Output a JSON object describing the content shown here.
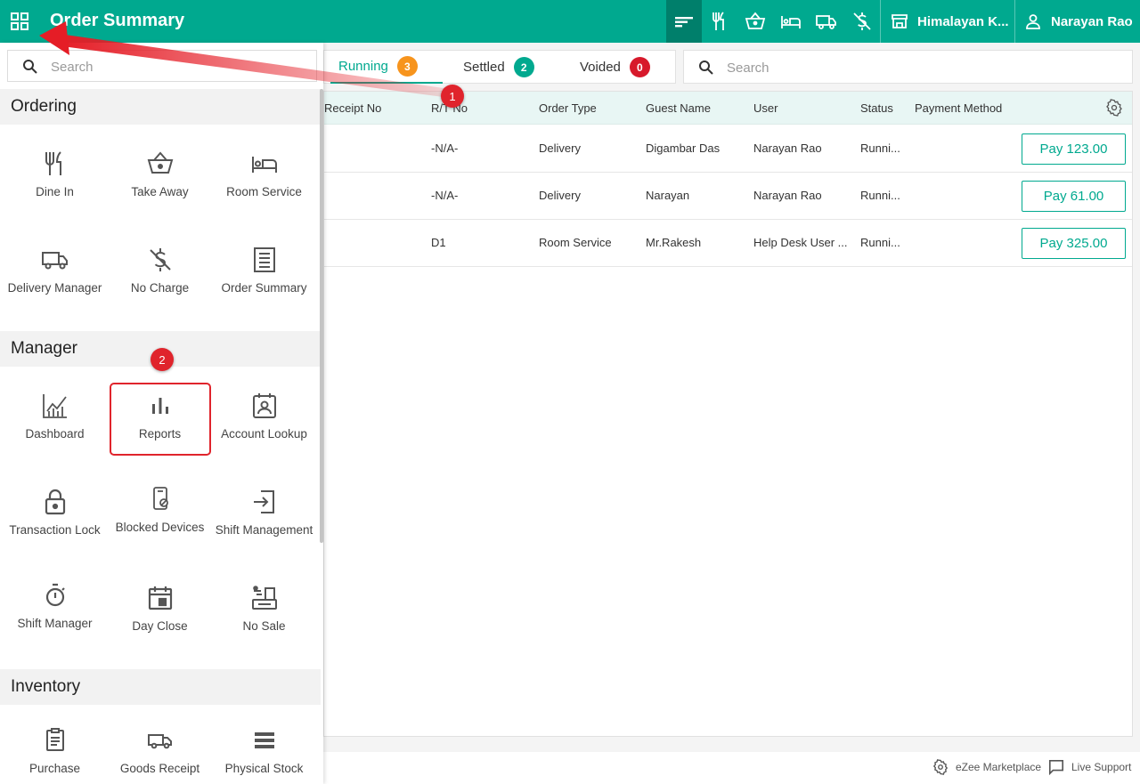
{
  "topbar": {
    "title": "Order Summary",
    "outlet": "Himalayan K...",
    "user": "Narayan Rao",
    "icons": [
      "order-summary-icon",
      "dine-in-icon",
      "take-away-icon",
      "room-service-icon",
      "delivery-icon",
      "no-charge-icon"
    ]
  },
  "sidebar": {
    "search_placeholder": "Search",
    "sections": {
      "ordering": {
        "title": "Ordering",
        "items": [
          {
            "label": "Dine In",
            "icon": "dine-in-icon"
          },
          {
            "label": "Take Away",
            "icon": "take-away-icon"
          },
          {
            "label": "Room Service",
            "icon": "room-service-icon"
          },
          {
            "label": "Delivery Manager",
            "icon": "delivery-icon"
          },
          {
            "label": "No Charge",
            "icon": "no-charge-icon"
          },
          {
            "label": "Order Summary",
            "icon": "receipt-icon"
          }
        ]
      },
      "manager": {
        "title": "Manager",
        "items": [
          {
            "label": "Dashboard",
            "icon": "dashboard-icon"
          },
          {
            "label": "Reports",
            "icon": "reports-icon"
          },
          {
            "label": "Account Lookup",
            "icon": "account-lookup-icon"
          },
          {
            "label": "Transaction Lock",
            "icon": "lock-icon"
          },
          {
            "label": "Blocked Devices",
            "icon": "blocked-device-icon"
          },
          {
            "label": "Shift Management",
            "icon": "shift-icon"
          },
          {
            "label": "Shift Manager",
            "icon": "timer-icon"
          },
          {
            "label": "Day Close",
            "icon": "calendar-icon"
          },
          {
            "label": "No Sale",
            "icon": "cash-register-icon"
          }
        ]
      },
      "inventory": {
        "title": "Inventory",
        "items": [
          {
            "label": "Purchase",
            "icon": "clipboard-icon"
          },
          {
            "label": "Goods Receipt",
            "icon": "truck-icon"
          },
          {
            "label": "Physical Stock",
            "icon": "stock-icon"
          }
        ]
      }
    }
  },
  "tabs": [
    {
      "label": "Running",
      "count": "3",
      "color": "#f7941d"
    },
    {
      "label": "Settled",
      "count": "2",
      "color": "#00a98f"
    },
    {
      "label": "Voided",
      "count": "0",
      "color": "#d7192b"
    }
  ],
  "search": {
    "placeholder": "Search"
  },
  "table": {
    "headers": [
      "Receipt No",
      "R/T No",
      "Order Type",
      "Guest Name",
      "User",
      "Status",
      "Payment Method"
    ],
    "rows": [
      {
        "receipt": "",
        "rt": "-N/A-",
        "type": "Delivery",
        "guest": "Digambar Das",
        "user": "Narayan Rao",
        "status": "Runni...",
        "payment": "",
        "pay": "Pay 123.00"
      },
      {
        "receipt": "",
        "rt": "-N/A-",
        "type": "Delivery",
        "guest": "Narayan",
        "user": "Narayan Rao",
        "status": "Runni...",
        "payment": "",
        "pay": "Pay 61.00"
      },
      {
        "receipt": "",
        "rt": "D1",
        "type": "Room Service",
        "guest": "Mr.Rakesh",
        "user": "Help Desk User ...",
        "status": "Runni...",
        "payment": "",
        "pay": "Pay 325.00"
      }
    ]
  },
  "footer": {
    "marketplace": "eZee Marketplace",
    "support": "Live Support"
  },
  "annotations": {
    "step1": "1",
    "step2": "2"
  },
  "colors": {
    "brand": "#00a98f",
    "brand_dark": "#007f6b",
    "annotation": "#e0242c"
  }
}
